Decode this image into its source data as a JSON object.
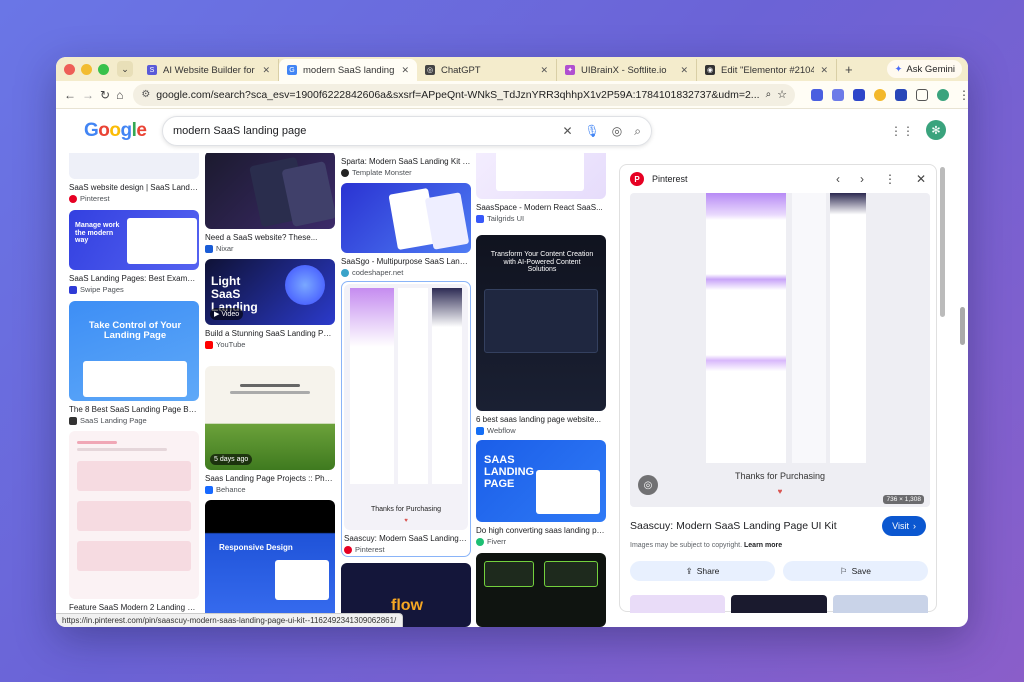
{
  "tabs": [
    {
      "title": "AI Website Builder for Wor",
      "fav_color": "#5a5bd8",
      "fav_letter": "S"
    },
    {
      "title": "modern SaaS landing page",
      "fav_color": "#4285f4",
      "fav_letter": "G",
      "active": true
    },
    {
      "title": "ChatGPT",
      "fav_color": "#444444",
      "fav_letter": "◎"
    },
    {
      "title": "UIBrainX - Softlite.io",
      "fav_color": "#b04fd0",
      "fav_letter": "✦"
    },
    {
      "title": "Edit \"Elementor #21046\" ‹",
      "fav_color": "#333333",
      "fav_letter": "◉"
    }
  ],
  "gemini_label": "Ask Gemini",
  "url": "google.com/search?sca_esv=1900f6222842606a&sxsrf=APpeQnt-WNkS_TdJznYRR3qhhpX1v2P59A:1784101832737&udm=2...",
  "search_query": "modern SaaS landing page",
  "results": {
    "col1": [
      {
        "title": "SaaS website design | SaaS Landing...",
        "source": "Pinterest",
        "src_color": "#e60023"
      },
      {
        "title": "SaaS Landing Pages: Best Examples,...",
        "source": "Swipe Pages",
        "src_color": "#2f3bd6",
        "thumb_text": "Manage work the modern way"
      },
      {
        "title": "The 8 Best SaaS Landing Page Builde...",
        "source": "SaaS Landing Page",
        "src_color": "#333333",
        "thumb_text": "Take Control of Your Landing Page"
      },
      {
        "title": "Feature SaaS Modern 2 Landing Page...",
        "source": "",
        "src_color": "#999999"
      }
    ],
    "col2": [
      {
        "title": "Need a SaaS website? These...",
        "source": "Nixar",
        "src_color": "#1a5cd6"
      },
      {
        "title": "Build a Stunning SaaS Landing Page...",
        "source": "YouTube",
        "src_color": "#ff0000",
        "badge": "Video",
        "thumb_text": "Light SaaS Landing"
      },
      {
        "title": "Saas Landing Page Projects :: Photos...",
        "source": "Behance",
        "src_color": "#1769ff",
        "badge": "5 days ago"
      },
      {
        "title": "",
        "source": "",
        "src_color": "#999999",
        "thumb_text": "Responsive Design"
      }
    ],
    "col3": [
      {
        "title": "Sparta: Modern SaaS Landing Kit —...",
        "source": "Template Monster",
        "src_color": "#222222"
      },
      {
        "title": "SaaSgo - Multipurpose SaaS Landing...",
        "source": "codeshaper.net",
        "src_color": "#3aa3c9"
      },
      {
        "title": "Saascuy: Modern SaaS Landing Page...",
        "source": "Pinterest",
        "src_color": "#e60023",
        "thumb_text": "Thanks for Purchasing"
      },
      {
        "title": "",
        "source": "",
        "src_color": "#999999",
        "thumb_text": "flow"
      }
    ],
    "col4": [
      {
        "title": "SaasSpace - Modern React SaaS...",
        "source": "Tailgrids UI",
        "src_color": "#3758f9"
      },
      {
        "title": "6 best saas landing page website...",
        "source": "Webflow",
        "src_color": "#146ef5",
        "thumb_text": "Transform Your Content Creation with AI-Powered Content Solutions"
      },
      {
        "title": "Do high converting saas landing pag...",
        "source": "Fiverr",
        "src_color": "#1dbf73",
        "thumb_text": "SAAS LANDING PAGE"
      },
      {
        "title": "",
        "source": "",
        "src_color": "#999999"
      }
    ]
  },
  "status_url": "https://in.pinterest.com/pin/saascuy-modern-saas-landing-page-ui-kit--1162492341309062861/",
  "preview": {
    "source": "Pinterest",
    "image_caption": "Thanks for Purchasing",
    "dimensions": "736 × 1,308",
    "title": "Saascuy: Modern SaaS Landing Page UI Kit",
    "visit_label": "Visit",
    "copyright": "Images may be subject to copyright.",
    "learn_more": "Learn more",
    "share_label": "Share",
    "save_label": "Save"
  }
}
